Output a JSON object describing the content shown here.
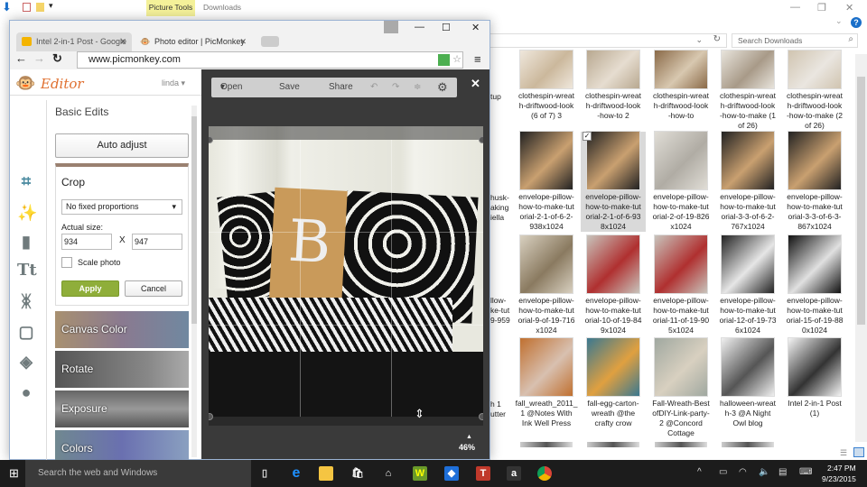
{
  "explorer": {
    "contextual_tab": "Picture Tools",
    "title": "Downloads",
    "search_placeholder": "Search Downloads",
    "files": [
      {
        "name": "clothespin-wreath-driftwood-look (6 of 7) 3",
        "lines": [
          "clothespin-wreat",
          "h-driftwood-look",
          "(6 of 7) 3"
        ],
        "colors": [
          "#efe7dc",
          "#cbb89c"
        ]
      },
      {
        "name": "clothespin-wreath-driftwood-look-how-to 2",
        "lines": [
          "clothespin-wreat",
          "h-driftwood-look",
          "-how-to 2"
        ],
        "colors": [
          "#b8a890",
          "#e6ddd0"
        ]
      },
      {
        "name": "clothespin-wreath-driftwood-look-how-to",
        "lines": [
          "clothespin-wreat",
          "h-driftwood-look",
          "-how-to"
        ],
        "colors": [
          "#8a6a48",
          "#d8c8b0"
        ]
      },
      {
        "name": "clothespin-wreath-driftwood-look-how-to-make (1 of 26)",
        "lines": [
          "clothespin-wreat",
          "h-driftwood-look",
          "-how-to-make (1",
          "of  26)"
        ],
        "colors": [
          "#e8e4dc",
          "#a89a88"
        ]
      },
      {
        "name": "clothespin-wreath-driftwood-look-how-to-make (2 of 26)",
        "lines": [
          "clothespin-wreat",
          "h-driftwood-look",
          "-how-to-make (2",
          "of  26)"
        ],
        "colors": [
          "#d0c4b0",
          "#eae6e0"
        ]
      },
      {
        "name": "envelope-pillow-how-to-make-tutorial-2-1-of-6-2-938x1024",
        "lines": [
          "envelope-pillow-",
          "how-to-make-tut",
          "orial-2-1-of-6-2-",
          "938x1024"
        ],
        "colors": [
          "#222",
          "#c9a070"
        ]
      },
      {
        "name": "envelope-pillow-how-to-make-tutorial-2-1-of-6-938x1024",
        "lines": [
          "envelope-pillow-",
          "how-to-make-tut",
          "orial-2-1-of-6-93",
          "8x1024"
        ],
        "colors": [
          "#222",
          "#c9a070"
        ],
        "selected": true
      },
      {
        "name": "envelope-pillow-how-to-make-tutorial-2-of-19-826x1024",
        "lines": [
          "envelope-pillow-",
          "how-to-make-tut",
          "orial-2-of-19-826",
          "x1024"
        ],
        "colors": [
          "#e0ddd6",
          "#b0aca4"
        ]
      },
      {
        "name": "envelope-pillow-how-to-make-tutorial-3-3-of-6-2-767x1024",
        "lines": [
          "envelope-pillow-",
          "how-to-make-tut",
          "orial-3-3-of-6-2-",
          "767x1024"
        ],
        "colors": [
          "#222",
          "#c9a070"
        ]
      },
      {
        "name": "envelope-pillow-how-to-make-tutorial-3-3-of-6-3-867x1024",
        "lines": [
          "envelope-pillow-",
          "how-to-make-tut",
          "orial-3-3-of-6-3-",
          "867x1024"
        ],
        "colors": [
          "#222",
          "#c9a070"
        ]
      },
      {
        "name": "envelope-pillow-how-to-make-tutorial-9-of-19-716x1024",
        "lines": [
          "envelope-pillow-",
          "how-to-make-tut",
          "orial-9-of-19-716",
          "x1024"
        ],
        "colors": [
          "#d8d0c0",
          "#8a7a60"
        ]
      },
      {
        "name": "envelope-pillow-how-to-make-tutorial-10-of-19-849x1024",
        "lines": [
          "envelope-pillow-",
          "how-to-make-tut",
          "orial-10-of-19-84",
          "9x1024"
        ],
        "colors": [
          "#c8c4bc",
          "#b03030"
        ]
      },
      {
        "name": "envelope-pillow-how-to-make-tutorial-11-of-19-905x1024",
        "lines": [
          "envelope-pillow-",
          "how-to-make-tut",
          "orial-11-of-19-90",
          "5x1024"
        ],
        "colors": [
          "#c8c4bc",
          "#b03030"
        ]
      },
      {
        "name": "envelope-pillow-how-to-make-tutorial-12-of-19-736x1024",
        "lines": [
          "envelope-pillow-",
          "how-to-make-tut",
          "orial-12-of-19-73",
          "6x1024"
        ],
        "colors": [
          "#222",
          "#e6e6e6"
        ]
      },
      {
        "name": "envelope-pillow-how-to-make-tutorial-15-of-19-880x1024",
        "lines": [
          "envelope-pillow-",
          "how-to-make-tut",
          "orial-15-of-19-88",
          "0x1024"
        ],
        "colors": [
          "#111",
          "#e0e0e0"
        ]
      },
      {
        "name": "fall_wreath_2011_1 @Notes With Ink Well Press",
        "lines": [
          "fall_wreath_2011_",
          "1 @Notes With",
          "Ink Well Press"
        ],
        "colors": [
          "#c07030",
          "#d8c0b0"
        ]
      },
      {
        "name": "fall-egg-carton-wreath @the crafty crow",
        "lines": [
          "fall-egg-carton-",
          "wreath @the",
          "crafty crow"
        ],
        "colors": [
          "#3a7890",
          "#e0a040"
        ]
      },
      {
        "name": "Fall-Wreath-BestofDIY-Link-party-2 @Concord Cottage",
        "lines": [
          "Fall-Wreath-Best",
          "ofDIY-Link-party-",
          "2 @Concord",
          "Cottage"
        ],
        "colors": [
          "#a0a8a0",
          "#d8d0c0"
        ]
      },
      {
        "name": "halloween-wreath-3 @A Night Owl blog",
        "lines": [
          "halloween-wreat",
          "h-3 @A Night",
          "Owl blog"
        ],
        "colors": [
          "#f0f0f0",
          "#555"
        ]
      },
      {
        "name": "Intel 2-in-1 Post (1)",
        "lines": [
          "Intel 2-in-1 Post",
          "(1)"
        ],
        "colors": [
          "#f4f4f4",
          "#333"
        ]
      }
    ],
    "partial_column": [
      "tup",
      "husk-",
      "aking",
      "iella",
      "llow-",
      "ke-tut",
      "9-959",
      "h 1",
      "utter"
    ]
  },
  "browser": {
    "tabs": [
      {
        "label": "Intel 2-in-1 Post - Google"
      },
      {
        "label": "Photo editor | PicMonkey"
      }
    ],
    "url": "www.picmonkey.com"
  },
  "editor": {
    "logo": "Editor",
    "user": "linda",
    "toolbar": {
      "open": "Open",
      "save": "Save",
      "share": "Share"
    },
    "panel_title": "Basic Edits",
    "auto_adjust": "Auto adjust",
    "crop": {
      "title": "Crop",
      "proportion": "No fixed proportions",
      "size_label": "Actual size:",
      "width": "934",
      "height": "947",
      "x": "X",
      "scale_label": "Scale photo",
      "scale_checked": false,
      "apply": "Apply",
      "cancel": "Cancel"
    },
    "sections": [
      "Canvas Color",
      "Rotate",
      "Exposure",
      "Colors"
    ],
    "zoom": "46%",
    "accent": "#8fae3a"
  },
  "taskbar": {
    "search": "Search the web and Windows",
    "time": "2:47 PM",
    "date": "9/23/2015"
  }
}
